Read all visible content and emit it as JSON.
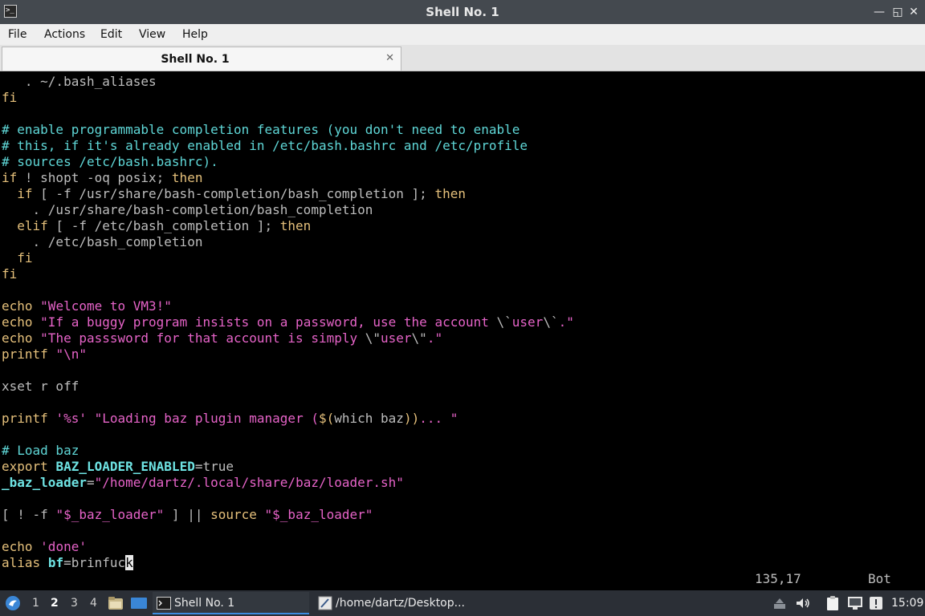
{
  "window": {
    "title": "Shell No. 1",
    "app_icon_glyph": ">_",
    "icon_names": [
      "terminal-icon",
      "minimize-icon",
      "restore-icon",
      "maximize-icon",
      "close-icon"
    ],
    "buttons": {
      "minimize": "—",
      "restore": "◱",
      "maximize": "□",
      "close": "✕"
    }
  },
  "menu": [
    "File",
    "Actions",
    "Edit",
    "View",
    "Help"
  ],
  "tab": {
    "label": "Shell No. 1",
    "close": "✕"
  },
  "colors": {
    "default": "#bdbdbd",
    "comment": "#5fd7d7",
    "keyword": "#e5c07b",
    "string": "#e663c8",
    "bold_var": "#6ee3e3",
    "accent": "#3c8ce0"
  },
  "terminal": {
    "lines": [
      [
        {
          "t": "   . ~/.bash_aliases",
          "c": "default"
        }
      ],
      [
        {
          "t": "fi",
          "c": "keyword"
        }
      ],
      [],
      [
        {
          "t": "# enable programmable completion features (you don't need to enable",
          "c": "comment"
        }
      ],
      [
        {
          "t": "# this, if it's already enabled in /etc/bash.bashrc and /etc/profile",
          "c": "comment"
        }
      ],
      [
        {
          "t": "# sources /etc/bash.bashrc).",
          "c": "comment"
        }
      ],
      [
        {
          "t": "if",
          "c": "keyword"
        },
        {
          "t": " ! shopt -oq posix; ",
          "c": "default"
        },
        {
          "t": "then",
          "c": "keyword"
        }
      ],
      [
        {
          "t": "  ",
          "c": "default"
        },
        {
          "t": "if",
          "c": "keyword"
        },
        {
          "t": " [ -f /usr/share/bash-completion/bash_completion ]; ",
          "c": "default"
        },
        {
          "t": "then",
          "c": "keyword"
        }
      ],
      [
        {
          "t": "    . /usr/share/bash-completion/bash_completion",
          "c": "default"
        }
      ],
      [
        {
          "t": "  ",
          "c": "default"
        },
        {
          "t": "elif",
          "c": "keyword"
        },
        {
          "t": " [ -f /etc/bash_completion ]; ",
          "c": "default"
        },
        {
          "t": "then",
          "c": "keyword"
        }
      ],
      [
        {
          "t": "    . /etc/bash_completion",
          "c": "default"
        }
      ],
      [
        {
          "t": "  ",
          "c": "default"
        },
        {
          "t": "fi",
          "c": "keyword"
        }
      ],
      [
        {
          "t": "fi",
          "c": "keyword"
        }
      ],
      [],
      [
        {
          "t": "echo",
          "c": "keyword"
        },
        {
          "t": " ",
          "c": "default"
        },
        {
          "t": "\"Welcome to VM3!\"",
          "c": "string"
        }
      ],
      [
        {
          "t": "echo",
          "c": "keyword"
        },
        {
          "t": " ",
          "c": "default"
        },
        {
          "t": "\"If a buggy program insists on a password, use the account ",
          "c": "string"
        },
        {
          "t": "\\`",
          "c": "default"
        },
        {
          "t": "user",
          "c": "string"
        },
        {
          "t": "\\`",
          "c": "default"
        },
        {
          "t": ".\"",
          "c": "string"
        }
      ],
      [
        {
          "t": "echo",
          "c": "keyword"
        },
        {
          "t": " ",
          "c": "default"
        },
        {
          "t": "\"The passsword for that account is simply ",
          "c": "string"
        },
        {
          "t": "\\\"",
          "c": "default"
        },
        {
          "t": "user",
          "c": "string"
        },
        {
          "t": "\\\"",
          "c": "default"
        },
        {
          "t": ".\"",
          "c": "string"
        }
      ],
      [
        {
          "t": "printf",
          "c": "keyword"
        },
        {
          "t": " ",
          "c": "default"
        },
        {
          "t": "\"\\n\"",
          "c": "string"
        }
      ],
      [],
      [
        {
          "t": "xset r off",
          "c": "default"
        }
      ],
      [],
      [
        {
          "t": "printf",
          "c": "keyword"
        },
        {
          "t": " ",
          "c": "default"
        },
        {
          "t": "'%s'",
          "c": "string"
        },
        {
          "t": " ",
          "c": "default"
        },
        {
          "t": "\"Loading baz plugin manager (",
          "c": "string"
        },
        {
          "t": "$(",
          "c": "keyword"
        },
        {
          "t": "which baz",
          "c": "default"
        },
        {
          "t": "))",
          "c": "keyword"
        },
        {
          "t": "... \"",
          "c": "string"
        }
      ],
      [],
      [
        {
          "t": "# Load baz",
          "c": "comment"
        }
      ],
      [
        {
          "t": "export",
          "c": "keyword"
        },
        {
          "t": " ",
          "c": "default"
        },
        {
          "t": "BAZ_LOADER_ENABLED",
          "c": "bold_var",
          "b": true
        },
        {
          "t": "=true",
          "c": "default"
        }
      ],
      [
        {
          "t": "_baz_loader",
          "c": "bold_var",
          "b": true
        },
        {
          "t": "=",
          "c": "default"
        },
        {
          "t": "\"/home/dartz/.local/share/baz/loader.sh\"",
          "c": "string"
        }
      ],
      [],
      [
        {
          "t": "[ ! -f ",
          "c": "default"
        },
        {
          "t": "\"$_baz_loader\"",
          "c": "string"
        },
        {
          "t": " ] || ",
          "c": "default"
        },
        {
          "t": "source",
          "c": "keyword"
        },
        {
          "t": " ",
          "c": "default"
        },
        {
          "t": "\"$_baz_loader\"",
          "c": "string"
        }
      ],
      [],
      [
        {
          "t": "echo",
          "c": "keyword"
        },
        {
          "t": " ",
          "c": "default"
        },
        {
          "t": "'done'",
          "c": "string"
        }
      ],
      [
        {
          "t": "alias",
          "c": "keyword"
        },
        {
          "t": " ",
          "c": "default"
        },
        {
          "t": "bf",
          "c": "bold_var",
          "b": true
        },
        {
          "t": "=brinfuc",
          "c": "default"
        },
        {
          "t": "k",
          "c": "default",
          "cursor": true
        }
      ]
    ],
    "ruler": "135,17",
    "position": "Bot"
  },
  "taskbar": {
    "workspaces": [
      "1",
      "2",
      "3",
      "4"
    ],
    "active_workspace": "2",
    "tasks": [
      {
        "label": "Shell No. 1",
        "icon": "terminal-icon",
        "active": true
      },
      {
        "label": "/home/dartz/Desktop...",
        "icon": "text-editor-icon",
        "active": false
      }
    ],
    "clock": "15:09",
    "tray_icons": [
      "update-icon",
      "volume-icon",
      "clipboard-icon",
      "network-icon",
      "notification-icon"
    ],
    "launcher_icons": [
      "start-menu-icon",
      "file-manager-icon",
      "show-desktop-icon"
    ]
  }
}
